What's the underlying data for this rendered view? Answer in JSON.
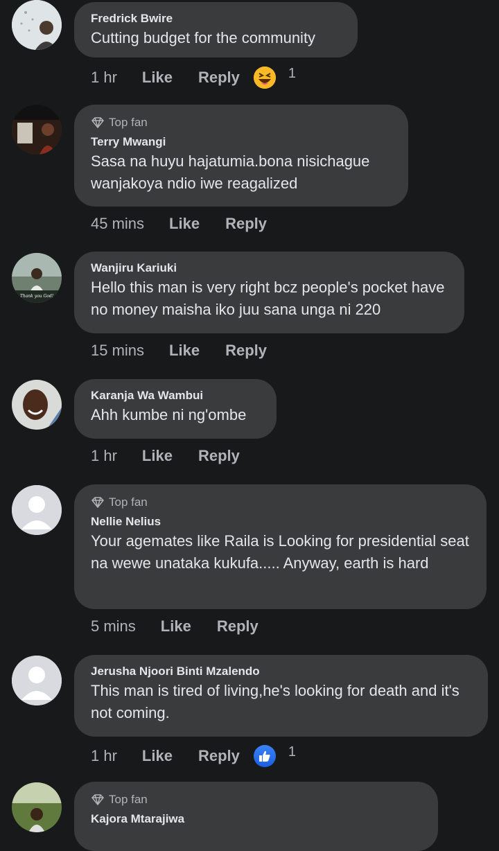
{
  "comments": [
    {
      "badge": "",
      "name": "Fredrick Bwire",
      "text": "Cutting budget for the community",
      "time": "1 hr",
      "like": "Like",
      "reply": "Reply",
      "reaction": "laugh",
      "reaction_count": "1"
    },
    {
      "badge": "Top fan",
      "name": "Terry Mwangi",
      "text": "Sasa na huyu hajatumia.bona nisichague wanjakoya ndio iwe reagalized",
      "time": "45 mins",
      "like": "Like",
      "reply": "Reply"
    },
    {
      "badge": "",
      "name": "Wanjiru Kariuki",
      "text": "Hello this man is very right bcz people's pocket have no money maisha iko juu sana unga  ni 220",
      "time": "15 mins",
      "like": "Like",
      "reply": "Reply",
      "avatar_text": "Thank you God!"
    },
    {
      "badge": "",
      "name": "Karanja Wa Wambui",
      "text": "Ahh kumbe ni ng'ombe",
      "time": "1 hr",
      "like": "Like",
      "reply": "Reply"
    },
    {
      "badge": "Top fan",
      "name": "Nellie Nelius",
      "text": "Your agemates like Raila is Looking for presidential seat na wewe unataka kukufa..... Anyway, earth is hard",
      "time": "5 mins",
      "like": "Like",
      "reply": "Reply"
    },
    {
      "badge": "",
      "name": "Jerusha Njoori Binti Mzalendo",
      "text": "This man is tired of living,he's looking for death and it's not coming.",
      "time": "1 hr",
      "like": "Like",
      "reply": "Reply",
      "reaction": "like",
      "reaction_count": "1"
    },
    {
      "badge": "Top fan",
      "name": "Kajora Mtarajiwa",
      "text": ""
    }
  ],
  "colors": {
    "background": "#18191a",
    "bubble": "#3a3b3c",
    "meta": "#b0b3b8",
    "text": "#e4e6eb",
    "like_blue": "#1b74e4",
    "haha_yellow": "#f7b928"
  }
}
